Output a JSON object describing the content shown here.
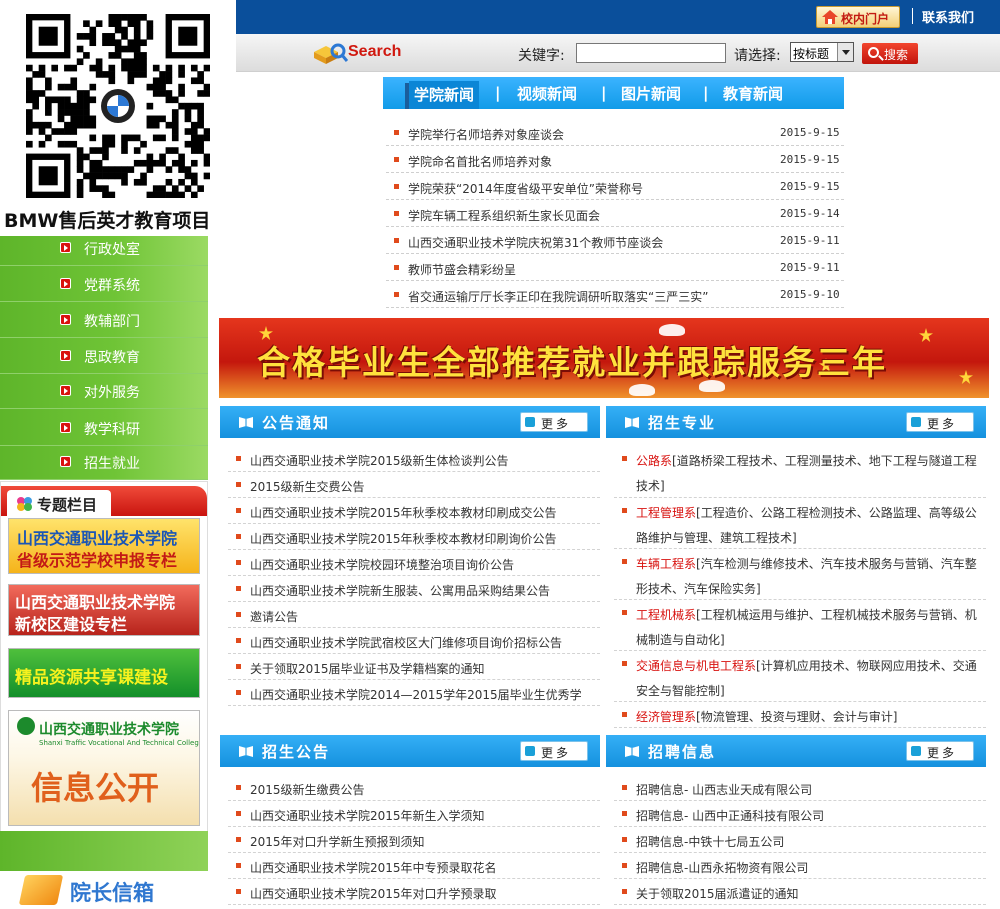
{
  "qr": {
    "caption": "BMW售后英才教育项目"
  },
  "left_nav": {
    "items": [
      {
        "label": "行政处室"
      },
      {
        "label": "党群系统"
      },
      {
        "label": "教辅部门"
      },
      {
        "label": "思政教育"
      },
      {
        "label": "对外服务"
      },
      {
        "label": "教学科研"
      },
      {
        "label": "招生就业"
      }
    ]
  },
  "special_column": {
    "title": "专题栏目",
    "banners": [
      {
        "line1": "山西交通职业技术学院",
        "line2": "省级示范学校申报专栏"
      },
      {
        "line1": "山西交通职业技术学院",
        "line2": "新校区建设专栏"
      },
      {
        "line1": "精品资源共享课建设"
      },
      {
        "line1": "山西交通职业技术学院",
        "line2": "Shanxi Traffic Vocational And Technical College",
        "line3": "信息公开"
      }
    ]
  },
  "mailbox": {
    "label": "院长信箱"
  },
  "topbar": {
    "portal": "校内门户",
    "contact": "联系我们"
  },
  "search": {
    "brand": "Search",
    "keyword_label": "关键字:",
    "keyword_value": "",
    "select_label": "请选择:",
    "select_value": "按标题",
    "button": "搜索"
  },
  "news": {
    "tabs": [
      {
        "label": "学院新闻",
        "active": true
      },
      {
        "label": "视频新闻"
      },
      {
        "label": "图片新闻"
      },
      {
        "label": "教育新闻"
      }
    ],
    "separator": "|",
    "items": [
      {
        "title": "学院举行名师培养对象座谈会",
        "date": "2015-9-15"
      },
      {
        "title": "学院命名首批名师培养对象",
        "date": "2015-9-15"
      },
      {
        "title": "学院荣获“2014年度省级平安单位”荣誉称号",
        "date": "2015-9-15"
      },
      {
        "title": "学院车辆工程系组织新生家长见面会",
        "date": "2015-9-14"
      },
      {
        "title": "山西交通职业技术学院庆祝第31个教师节座谈会",
        "date": "2015-9-11"
      },
      {
        "title": "教师节盛会精彩纷呈",
        "date": "2015-9-11"
      },
      {
        "title": "省交通运输厅厅长李正印在我院调研听取落实“三严三实”",
        "date": "2015-9-10"
      }
    ]
  },
  "banner": {
    "text": "合格毕业生全部推荐就业并跟踪服务三年"
  },
  "panels": {
    "more_label": "更多",
    "notices": {
      "title": "公告通知",
      "items": [
        "山西交通职业技术学院2015级新生体检谈判公告",
        "2015级新生交费公告",
        "山西交通职业技术学院2015年秋季校本教材印刷成交公告",
        "山西交通职业技术学院2015年秋季校本教材印刷询价公告",
        "山西交通职业技术学院校园环境整治项目询价公告",
        "山西交通职业技术学院新生服装、公寓用品采购结果公告",
        "邀请公告",
        "山西交通职业技术学院武宿校区大门维修项目询价招标公告",
        "关于领取2015届毕业证书及学籍档案的通知",
        "山西交通职业技术学院2014—2015学年2015届毕业生优秀学"
      ]
    },
    "majors": {
      "title": "招生专业",
      "items": [
        {
          "dept": "公路系",
          "desc": "[道路桥梁工程技术、工程测量技术、地下工程与隧道工程技术]"
        },
        {
          "dept": "工程管理系",
          "desc": "[工程造价、公路工程检测技术、公路监理、高等级公路维护与管理、建筑工程技术]"
        },
        {
          "dept": "车辆工程系",
          "desc": "[汽车检测与维修技术、汽车技术服务与营销、汽车整形技术、汽车保险实务]"
        },
        {
          "dept": "工程机械系",
          "desc": "[工程机械运用与维护、工程机械技术服务与营销、机械制造与自动化]"
        },
        {
          "dept": "交通信息与机电工程系",
          "desc": "[计算机应用技术、物联网应用技术、交通安全与智能控制]"
        },
        {
          "dept": "经济管理系",
          "desc": "[物流管理、投资与理财、会计与审计]"
        }
      ]
    },
    "admissions": {
      "title": "招生公告",
      "items": [
        "2015级新生缴费公告",
        "山西交通职业技术学院2015年新生入学须知",
        "2015年对口升学新生预报到须知",
        "山西交通职业技术学院2015年中专预录取花名",
        "山西交通职业技术学院2015年对口升学预录取"
      ]
    },
    "jobs": {
      "title": "招聘信息",
      "items": [
        "招聘信息- 山西志业天成有限公司",
        "招聘信息- 山西中正通科技有限公司",
        "招聘信息-中铁十七局五公司",
        "招聘信息-山西永拓物资有限公司",
        "关于领取2015届派遣证的通知"
      ]
    }
  },
  "colors": {
    "topbar": "#0a4f9b",
    "nav_green": "#6fc436",
    "accent_red": "#d8120f",
    "panel_blue": "#1591de"
  }
}
